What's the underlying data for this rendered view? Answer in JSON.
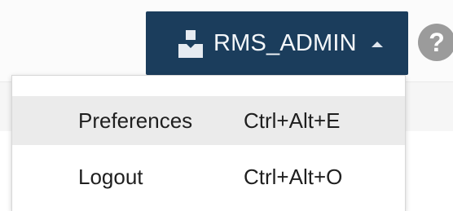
{
  "header": {
    "user_button": {
      "label": "RMS_ADMIN",
      "icon": "user-icon",
      "caret_icon": "caret-up-icon",
      "background_color": "#1b3d5c"
    },
    "help_button": {
      "icon": "help-icon",
      "glyph": "?"
    }
  },
  "user_menu": {
    "items": [
      {
        "label": "Preferences",
        "shortcut": "Ctrl+Alt+E",
        "highlighted": true
      },
      {
        "label": "Logout",
        "shortcut": "Ctrl+Alt+O",
        "highlighted": false
      }
    ]
  }
}
